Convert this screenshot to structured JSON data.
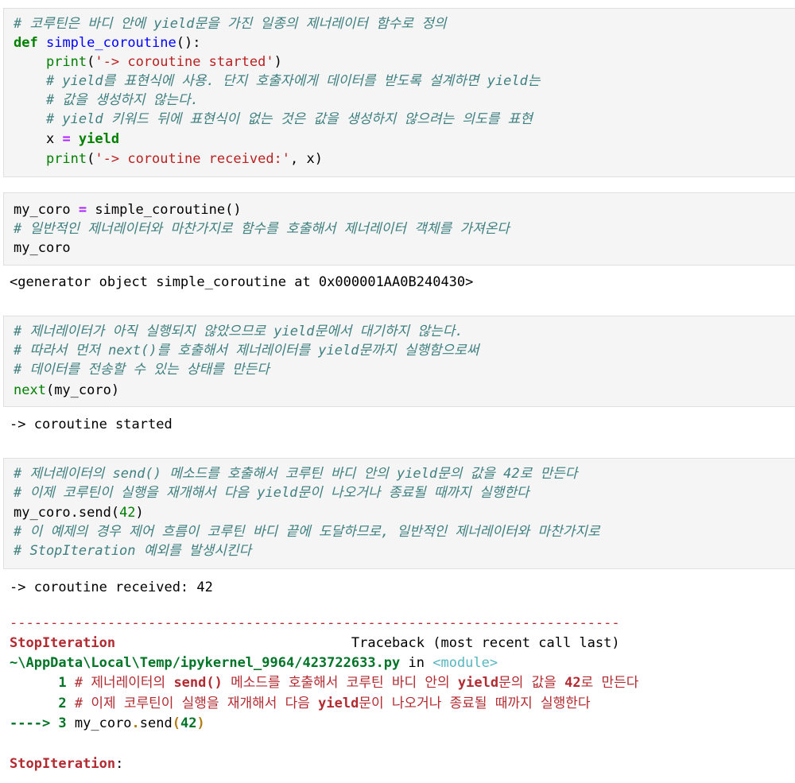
{
  "cell1": {
    "c1": "# 코루틴은 바디 안에 yield문을 가진 일종의 제너레이터 함수로 정의",
    "def_kw": "def",
    "func_name": "simple_coroutine",
    "def_tail": "():",
    "indent": "    ",
    "print1_fn": "print",
    "print1_open": "(",
    "print1_str": "'-> coroutine started'",
    "print1_close": ")",
    "c2": "# yield를 표현식에 사용. 단지 호출자에게 데이터를 받도록 설계하면 yield는",
    "c3": "# 값을 생성하지 않는다.",
    "c4": "# yield 키워드 뒤에 표현식이 없는 것은 값을 생성하지 않으려는 의도를 표현",
    "x_var": "x ",
    "eq": "=",
    "yield_kw": " yield",
    "print2_fn": "print",
    "print2_open": "(",
    "print2_str": "'-> coroutine received:'",
    "print2_close": ", x)"
  },
  "cell2": {
    "l1_var": "my_coro ",
    "l1_eq": "=",
    "l1_call": " simple_coroutine()",
    "c1": "# 일반적인 제너레이터와 마찬가지로 함수를 호출해서 제너레이터 객체를 가져온다",
    "l3": "my_coro"
  },
  "out2": "<generator object simple_coroutine at 0x000001AA0B240430>",
  "cell3": {
    "c1": "# 제너레이터가 아직 실행되지 않았으므로 yield문에서 대기하지 않는다.",
    "c2": "# 따라서 먼저 next()를 호출해서 제너레이터를 yield문까지 실행함으로써",
    "c3": "# 데이터를 전송할 수 있는 상태를 만든다",
    "next_fn": "next",
    "next_args": "(my_coro)"
  },
  "out3": "-> coroutine started",
  "cell4": {
    "c1": "# 제너레이터의 send() 메소드를 호출해서 코루틴 바디 안의 yield문의 값을 42로 만든다",
    "c2": "# 이제 코루틴이 실행을 재개해서 다음 yield문이 나오거나 종료될 때까지 실행한다",
    "send_pre": "my_coro.send(",
    "send_num": "42",
    "send_post": ")",
    "c3": "# 이 예제의 경우 제어 흐름이 코루틴 바디 끝에 도달하므로, 일반적인 제너레이터와 마찬가지로",
    "c4": "# StopIteration 예외를 발생시킨다"
  },
  "out4": {
    "received": "-> coroutine received: 42",
    "dashes": "---------------------------------------------------------------------------",
    "exc_name": "StopIteration",
    "traceback_label": "                             Traceback (most recent call last)",
    "path": "~\\AppData\\Local\\Temp/ipykernel_9964/423722633.py",
    "in_word": " in ",
    "module": "<module>",
    "tb1_num": "      1 ",
    "tb1_text_a": "# 제너레이터의 ",
    "tb1_bold1": "send()",
    "tb1_text_b": " 메소드를 호출해서 코루틴 바디 안의 ",
    "tb1_bold2": "yield",
    "tb1_text_c": "문의 값을 ",
    "tb1_bold3": "42",
    "tb1_text_d": "로 만든다",
    "tb2_num": "      2 ",
    "tb2_text_a": "# 이제 코루틴이 실행을 재개해서 다음 ",
    "tb2_bold1": "yield",
    "tb2_text_b": "문이 나오거나 종료될 때까지 실행한다",
    "tb3_arrow": "----> 3 ",
    "tb3_a": "my_coro",
    "tb3_dot": ".",
    "tb3_b": "send",
    "tb3_paren": "(",
    "tb3_num": "42",
    "tb3_close": ")",
    "final_exc": "StopIteration",
    "final_colon": ":"
  }
}
